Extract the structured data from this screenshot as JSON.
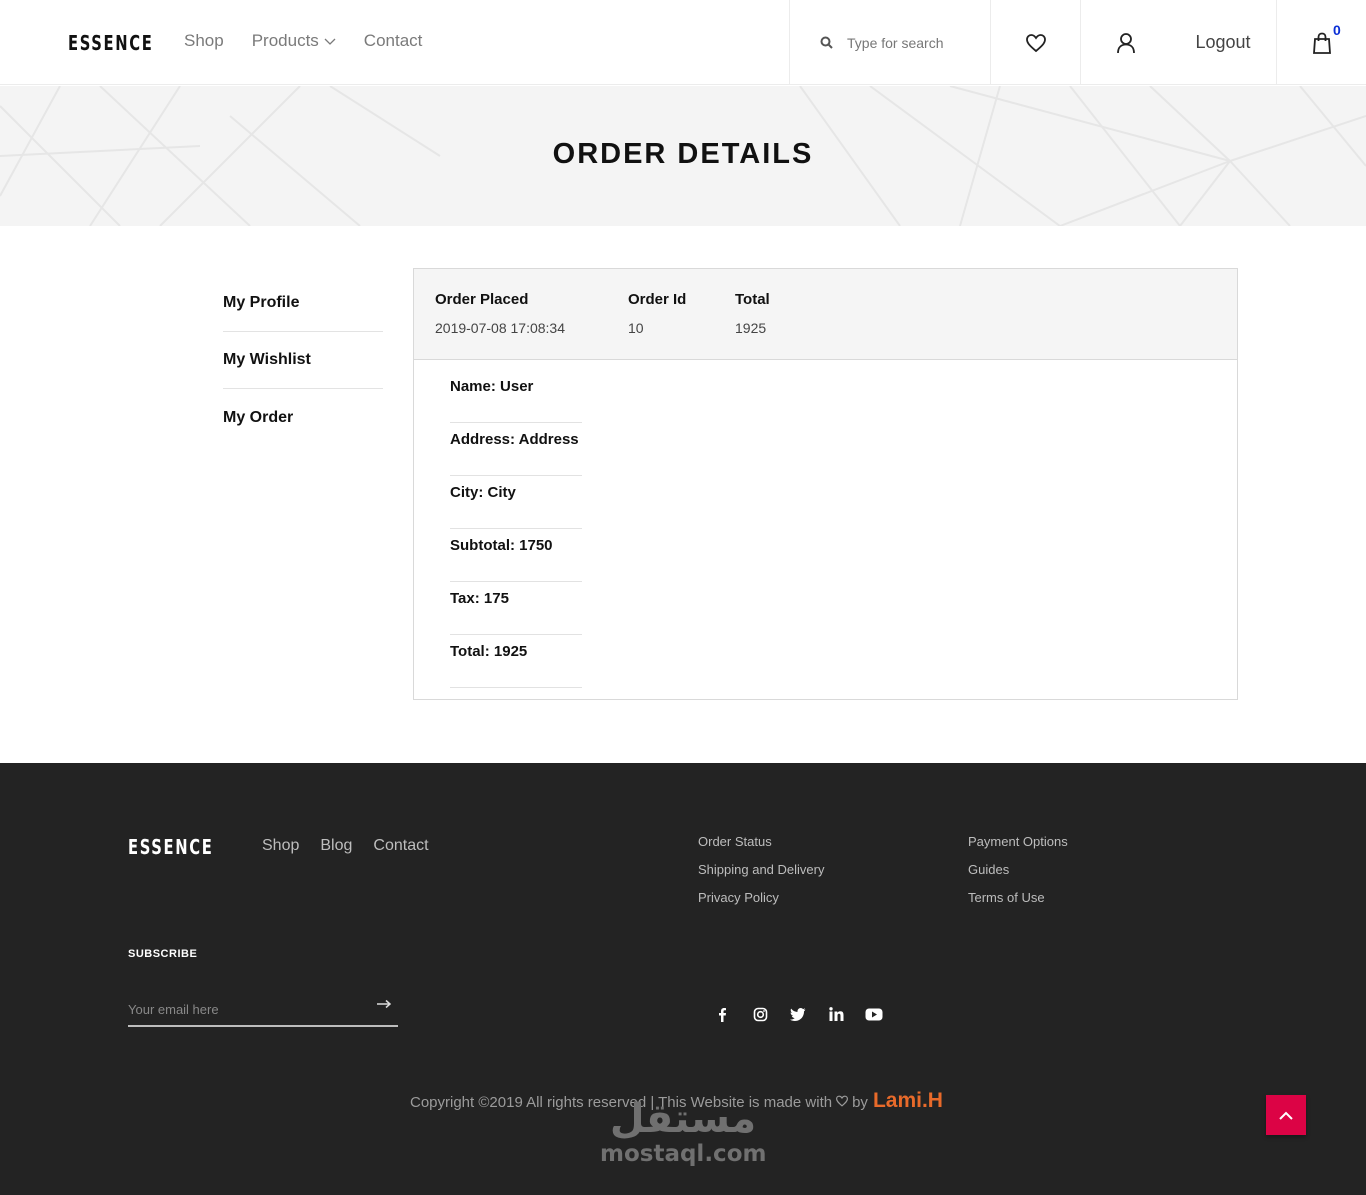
{
  "header": {
    "logo": "ESSENCE",
    "nav": [
      "Shop",
      "Products",
      "Contact"
    ],
    "search_placeholder": "Type for search",
    "logout_label": "Logout",
    "cart_count": "0"
  },
  "banner": {
    "title": "ORDER DETAILS"
  },
  "sidebar": {
    "items": [
      {
        "label": "My Profile"
      },
      {
        "label": "My Wishlist"
      },
      {
        "label": "My Order"
      }
    ]
  },
  "order": {
    "placed_label": "Order Placed",
    "placed_value": "2019-07-08 17:08:34",
    "id_label": "Order Id",
    "id_value": "10",
    "total_label": "Total",
    "total_value": "1925",
    "details": [
      "Name: User",
      "Address: Address",
      "City: City",
      "Subtotal: 1750",
      "Tax: 175",
      "Total: 1925"
    ]
  },
  "footer": {
    "logo": "ESSENCE",
    "nav": [
      "Shop",
      "Blog",
      "Contact"
    ],
    "links_col1": [
      "Order Status",
      "Shipping and Delivery",
      "Privacy Policy"
    ],
    "links_col2": [
      "Payment Options",
      "Guides",
      "Terms of Use"
    ],
    "subscribe_label": "SUBSCRIBE",
    "email_placeholder": "Your email here",
    "social_icons": [
      "facebook-icon",
      "instagram-icon",
      "twitter-icon",
      "linkedin-icon",
      "youtube-icon"
    ],
    "copyright_prefix": "Copyright ©2019 All rights reserved | This Website is made with",
    "copyright_by": "by",
    "author": "Lami.H",
    "watermark_ar": "مستقل",
    "watermark_en": "mostaql.com"
  },
  "colors": {
    "accent_red": "#dc0345",
    "author_orange": "#e86a2a",
    "cart_blue": "#0b2fd6",
    "footer_bg": "#232323"
  }
}
